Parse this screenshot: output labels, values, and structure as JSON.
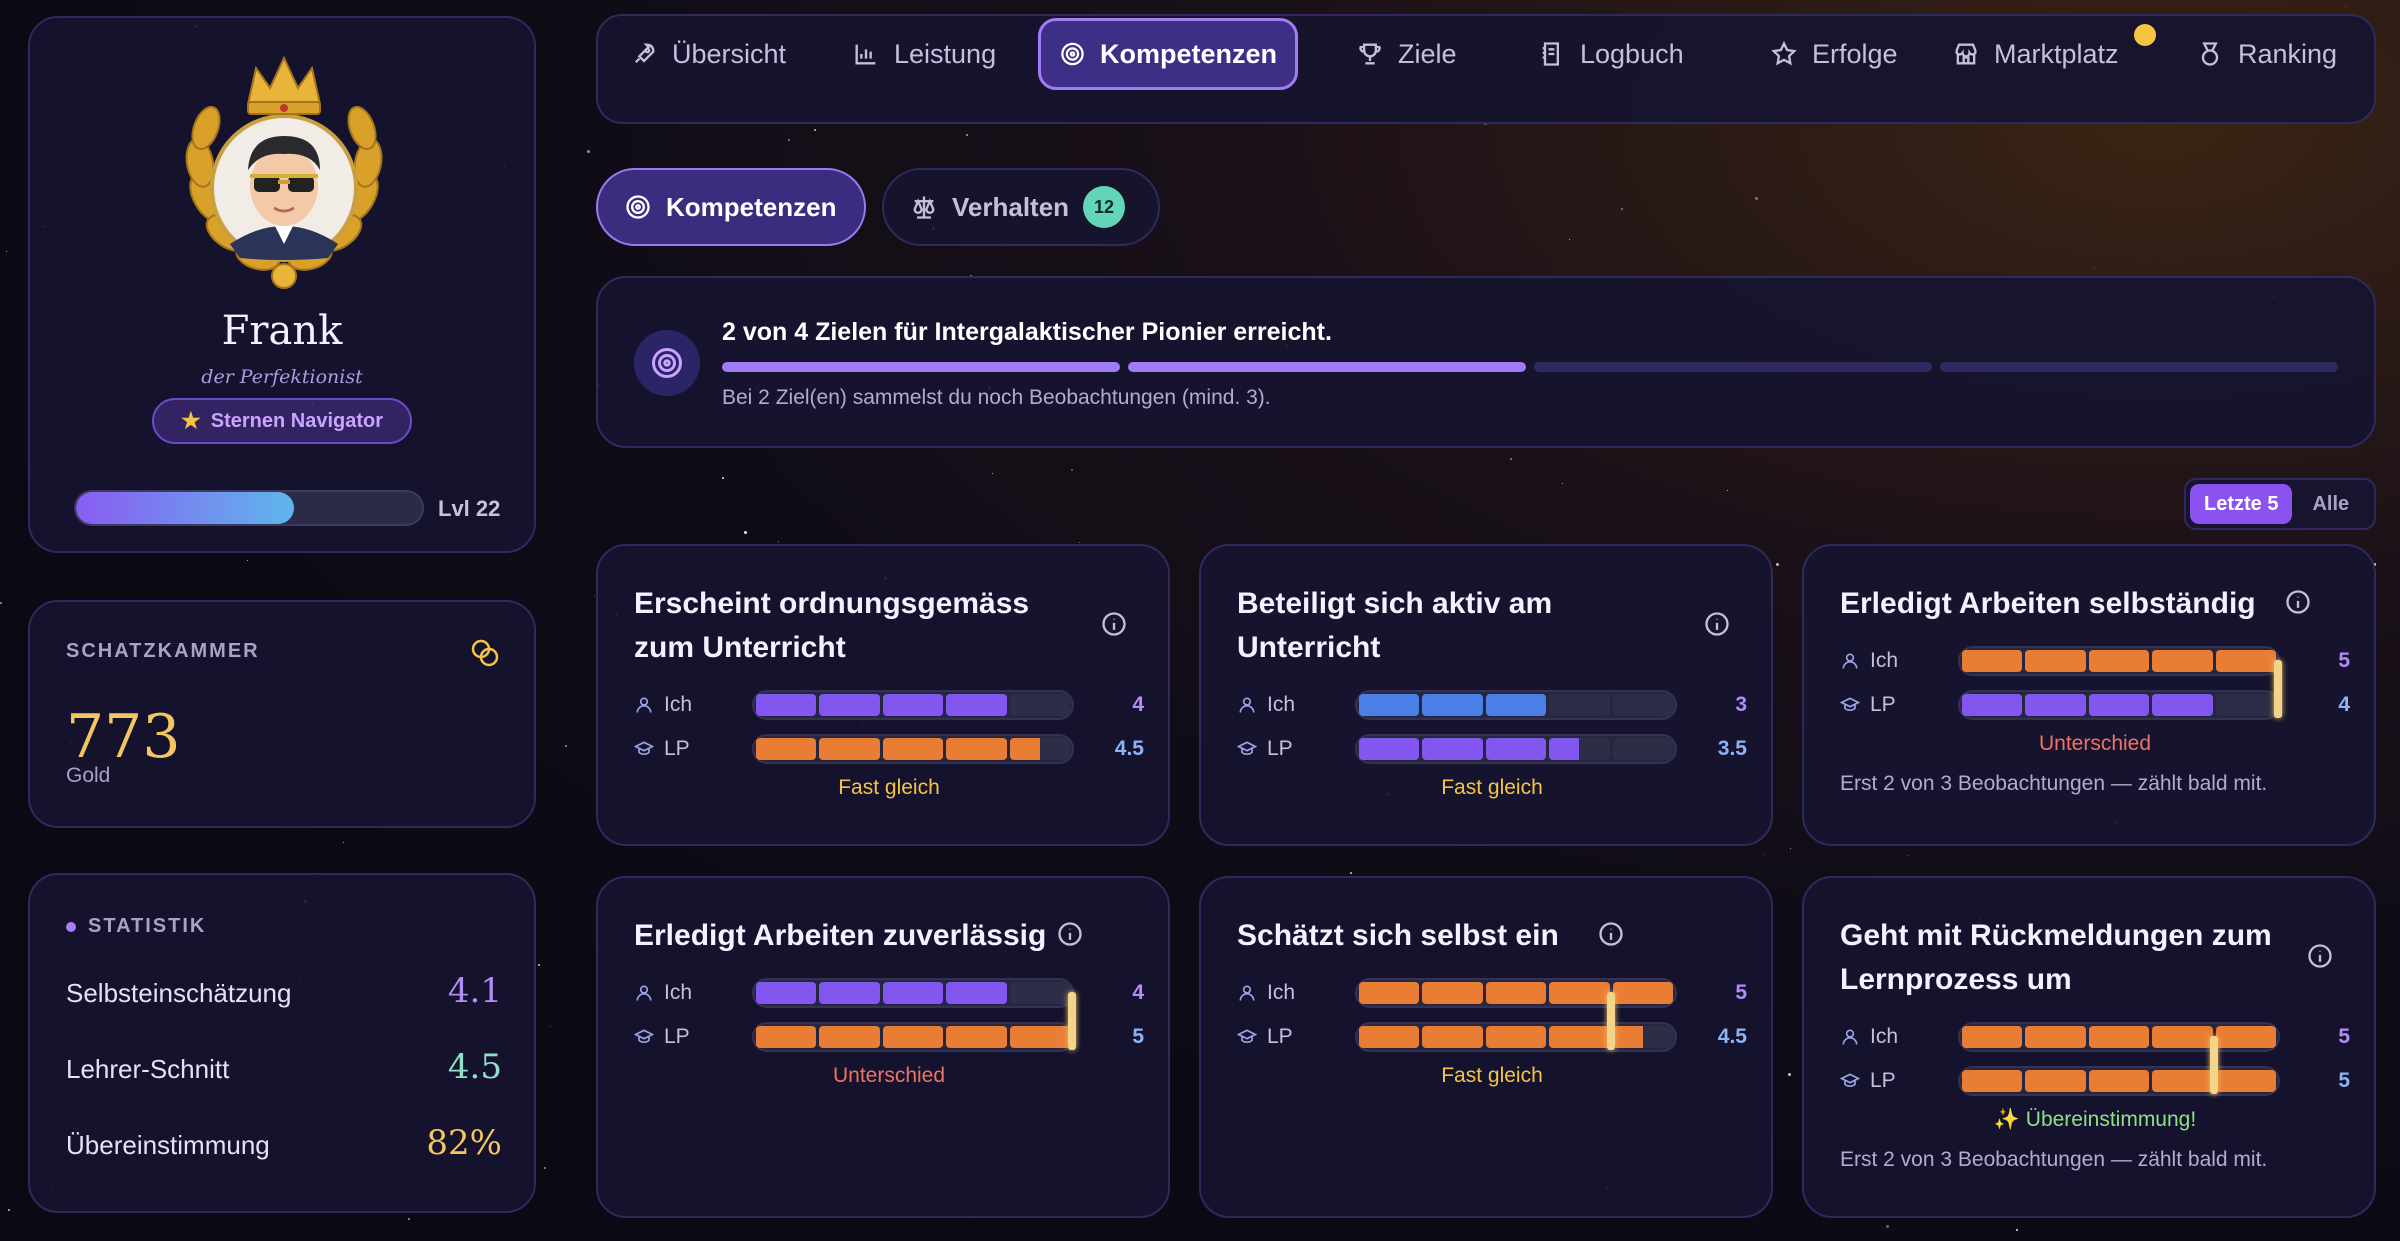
{
  "profile": {
    "name": "Frank",
    "subtitle": "der Perfektionist",
    "rank_badge": "Sternen Navigator",
    "rank_icon": "star-icon",
    "xp_progress": 0.63,
    "level": "Lvl 22"
  },
  "treasury": {
    "label": "SCHATZKAMMER",
    "value": "773",
    "unit": "Gold"
  },
  "stats": {
    "label": "STATISTIK",
    "rows": [
      {
        "label": "Selbsteinschätzung",
        "value": "4.1",
        "color": "#b48cf7"
      },
      {
        "label": "Lehrer-Schnitt",
        "value": "4.5",
        "color": "#8fe0c8"
      },
      {
        "label": "Übereinstimmung",
        "value": "82%",
        "color": "#f5c560"
      }
    ]
  },
  "nav": {
    "items": [
      {
        "label": "Übersicht",
        "icon": "rocket-icon"
      },
      {
        "label": "Leistung",
        "icon": "bar-chart-icon"
      },
      {
        "label": "Kompetenzen",
        "icon": "target-icon",
        "active": true
      },
      {
        "label": "Ziele",
        "icon": "trophy-icon"
      },
      {
        "label": "Logbuch",
        "icon": "notebook-icon"
      },
      {
        "label": "Erfolge",
        "icon": "star-icon"
      },
      {
        "label": "Marktplatz",
        "icon": "store-icon",
        "notification": true
      },
      {
        "label": "Ranking",
        "icon": "medal-icon"
      }
    ]
  },
  "subtabs": {
    "kompetenzen": "Kompetenzen",
    "verhalten": "Verhalten",
    "verhalten_count": "12"
  },
  "goal": {
    "title": "2 von 4 Zielen für Intergalaktischer Pionier erreicht.",
    "done": 2,
    "total": 4,
    "note": "Bei 2 Ziel(en) sammelst du noch Beobachtungen (mind. 3)."
  },
  "range_toggle": {
    "options": [
      "Letzte 5",
      "Alle"
    ],
    "selected": "Letzte 5"
  },
  "labels": {
    "self": "Ich",
    "teacher": "LP"
  },
  "colors": {
    "purple": "#8257f0",
    "orange": "#e97d34",
    "blue": "#4a7fe6",
    "self_value": "#b48cf7",
    "teacher_value": "#8eb3f5",
    "verdict_close": "#f5c542",
    "verdict_diff": "#f07264",
    "verdict_match": "#8fe08a"
  },
  "cards": [
    {
      "title": "Erscheint ordnungsgemäss zum Unterricht",
      "self": {
        "value": "4",
        "level": 4,
        "color": "purple"
      },
      "teacher": {
        "value": "4.5",
        "level": 4.5,
        "color": "orange"
      },
      "verdict": "Fast gleich",
      "verdict_type": "close",
      "note": ""
    },
    {
      "title": "Beteiligt sich aktiv am Unterricht",
      "self": {
        "value": "3",
        "level": 3,
        "color": "blue"
      },
      "teacher": {
        "value": "3.5",
        "level": 3.5,
        "color": "purple"
      },
      "verdict": "Fast gleich",
      "verdict_type": "close",
      "note": ""
    },
    {
      "title": "Erledigt Arbeiten selbständig",
      "self": {
        "value": "5",
        "level": 5,
        "color": "orange"
      },
      "teacher": {
        "value": "4",
        "level": 4,
        "color": "purple",
        "marker": 5
      },
      "verdict": "Unterschied",
      "verdict_type": "diff",
      "note": "Erst 2 von 3 Beobachtungen — zählt bald mit."
    },
    {
      "title": "Erledigt Arbeiten zuverlässig",
      "self": {
        "value": "4",
        "level": 4,
        "color": "purple"
      },
      "teacher": {
        "value": "5",
        "level": 5,
        "color": "orange",
        "marker": 5
      },
      "verdict": "Unterschied",
      "verdict_type": "diff",
      "note": ""
    },
    {
      "title": "Schätzt sich selbst ein",
      "self": {
        "value": "5",
        "level": 5,
        "color": "orange"
      },
      "teacher": {
        "value": "4.5",
        "level": 4.5,
        "color": "orange",
        "marker": 4
      },
      "verdict": "Fast gleich",
      "verdict_type": "close",
      "note": ""
    },
    {
      "title": "Geht mit Rückmeldungen zum Lernprozess um",
      "self": {
        "value": "5",
        "level": 5,
        "color": "orange"
      },
      "teacher": {
        "value": "5",
        "level": 5,
        "color": "orange",
        "marker": 4
      },
      "verdict": "✨ Übereinstimmung!",
      "verdict_type": "match",
      "note": "Erst 2 von 3 Beobachtungen — zählt bald mit."
    }
  ]
}
